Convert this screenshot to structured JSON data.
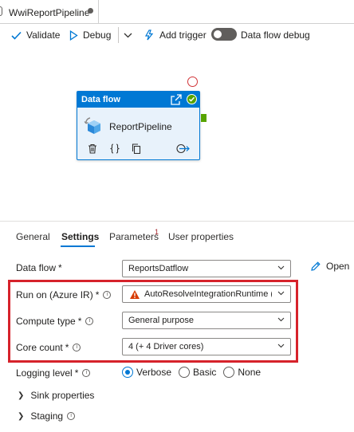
{
  "document_tab": {
    "title": "WwiReportPipeline"
  },
  "toolbar": {
    "validate_label": "Validate",
    "debug_label": "Debug",
    "add_trigger_label": "Add trigger",
    "dataflow_debug_label": "Data flow debug",
    "dataflow_debug_on": false
  },
  "canvas": {
    "activity": {
      "type_label": "Data flow",
      "name": "ReportPipeline",
      "status": "succeeded"
    }
  },
  "tabs": {
    "items": [
      {
        "label": "General"
      },
      {
        "label": "Settings"
      },
      {
        "label": "Parameters"
      },
      {
        "label": "User properties"
      }
    ],
    "active": "Settings",
    "parameters_badge": "1"
  },
  "form": {
    "data_flow": {
      "label": "Data flow",
      "required": "*",
      "value": "ReportsDatflow",
      "open_label": "Open"
    },
    "run_on": {
      "label": "Run on (Azure IR)",
      "required": "*",
      "value": "AutoResolveIntegrationRuntime (Ma..."
    },
    "compute_type": {
      "label": "Compute type",
      "required": "*",
      "value": "General purpose"
    },
    "core_count": {
      "label": "Core count",
      "required": "*",
      "value": "4 (+ 4 Driver cores)"
    },
    "logging_level": {
      "label": "Logging level",
      "required": "*",
      "options": [
        "Verbose",
        "Basic",
        "None"
      ],
      "selected": "Verbose"
    },
    "sink_properties_label": "Sink properties",
    "staging_label": "Staging"
  },
  "colors": {
    "accent": "#0078d4",
    "success": "#57a300",
    "highlight_border": "#d6222b",
    "warning": "#d83b01"
  }
}
